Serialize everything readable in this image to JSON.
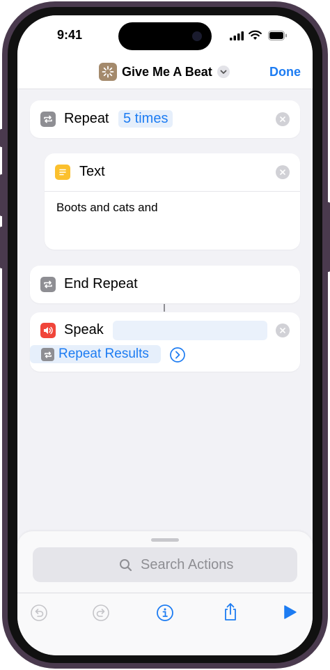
{
  "status_bar": {
    "time": "9:41"
  },
  "nav": {
    "title": "Give Me A Beat",
    "done_label": "Done"
  },
  "actions": {
    "repeat": {
      "label": "Repeat",
      "count_token": "5 times"
    },
    "text": {
      "label": "Text",
      "content": "Boots and cats and"
    },
    "end_repeat": {
      "label": "End Repeat"
    },
    "speak": {
      "label": "Speak",
      "input_token": "Repeat Results"
    }
  },
  "sheet": {
    "search_placeholder": "Search Actions"
  },
  "icons": {
    "app": "sparkle-icon",
    "repeat": "repeat-icon",
    "text": "text-lines-icon",
    "speak": "speaker-icon",
    "clear": "clear-icon",
    "search": "search-icon",
    "undo": "undo-icon",
    "redo": "redo-icon",
    "info": "info-icon",
    "share": "share-icon",
    "run": "play-icon"
  },
  "colors": {
    "accent": "#1d7cf2",
    "app_icon": "#a48a6c",
    "text_icon": "#fbc02d",
    "speak_icon": "#f0453a",
    "repeat_icon": "#8e8e93"
  }
}
